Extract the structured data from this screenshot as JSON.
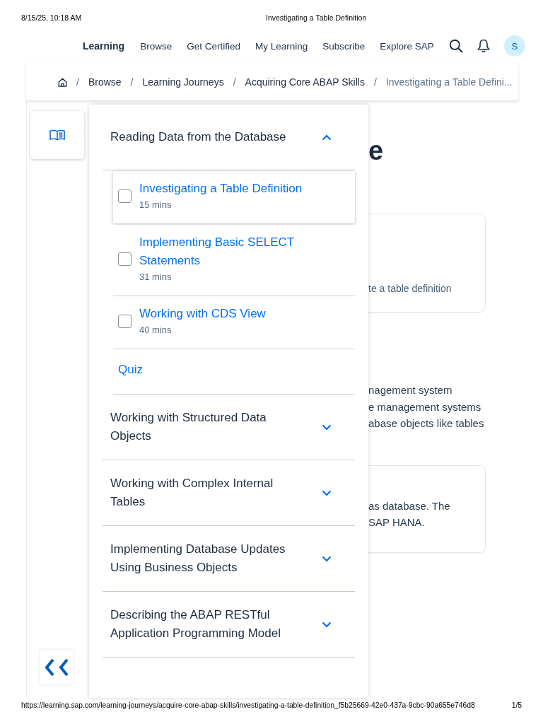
{
  "print_header": {
    "date": "8/15/25, 10:18 AM",
    "title": "Investigating a Table Definition"
  },
  "nav": {
    "brand": "Learning",
    "links": [
      "Browse",
      "Get Certified",
      "My Learning",
      "Subscribe",
      "Explore SAP"
    ],
    "avatar": "S"
  },
  "breadcrumb": {
    "separator": "/",
    "items": [
      {
        "label": "Browse",
        "current": false
      },
      {
        "label": "Learning Journeys",
        "current": false
      },
      {
        "label": "Acquiring Core ABAP Skills",
        "current": false
      },
      {
        "label": "Investigating a Table Defini...",
        "current": true
      }
    ]
  },
  "outline": {
    "sections": [
      {
        "title": "Reading Data from the Database",
        "expanded": true,
        "lessons": [
          {
            "kind": "lesson",
            "title": "Investigating a Table Definition",
            "duration": "15 mins",
            "checked": false,
            "selected": true
          },
          {
            "kind": "lesson",
            "title": "Implementing Basic SELECT Statements",
            "duration": "31 mins",
            "checked": false,
            "selected": false
          },
          {
            "kind": "lesson",
            "title": "Working with CDS View",
            "duration": "40 mins",
            "checked": false,
            "selected": false
          },
          {
            "kind": "quiz",
            "title": "Quiz",
            "selected": false
          }
        ]
      },
      {
        "title": "Working with Structured Data Objects",
        "expanded": false
      },
      {
        "title": "Working with Complex Internal Tables",
        "expanded": false
      },
      {
        "title": "Implementing Database Updates Using Business Objects",
        "expanded": false
      },
      {
        "title": "Describing the ABAP RESTful Application Programming Model",
        "expanded": false
      }
    ]
  },
  "background_content": {
    "heading": "e",
    "card_1": {
      "text": "te a table definition"
    },
    "paragraph_lines": [
      "nagement system",
      "e management systems",
      "abase objects like tables"
    ],
    "card_2": {
      "lines": [
        "as database. The",
        "SAP HANA."
      ]
    }
  },
  "print_footer": {
    "url": "https://learning.sap.com/learning-journeys/acquire-core-abap-skills/investigating-a-table-definition_f5b25669-42e0-437a-9cbc-90a655e746d8",
    "page": "1/5"
  }
}
